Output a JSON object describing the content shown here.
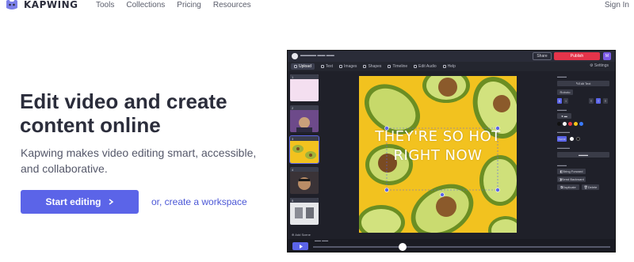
{
  "nav": {
    "brand": "KAPWING",
    "links": [
      "Tools",
      "Collections",
      "Pricing",
      "Resources"
    ],
    "sign_in": "Sign In"
  },
  "hero": {
    "title": "Edit video and create content online",
    "subtitle": "Kapwing makes video editing smart, accessible, and collaborative.",
    "cta_label": "Start editing",
    "alt_link": "or, create a workspace"
  },
  "editor": {
    "share": "Share",
    "publish": "Publish",
    "user_initial": "M",
    "tools": [
      "Upload",
      "Text",
      "Images",
      "Shapes",
      "Timeline",
      "Edit Audio",
      "Help"
    ],
    "settings": "Settings",
    "add_scene": "Add Scene",
    "overlay_text": "THEY'RE SO HOT RIGHT NOW",
    "props": {
      "edit_text": "Edit Text",
      "font": "Roboto",
      "ai_label": "AI",
      "bring_forward": "Bring Forward",
      "send_backward": "Send Backward",
      "duplicate": "Duplicate",
      "delete": "Delete",
      "none": "None"
    },
    "colors": {
      "accent": "#5b64e8",
      "publish": "#e5344a",
      "canvas": "#f2c21f"
    }
  }
}
